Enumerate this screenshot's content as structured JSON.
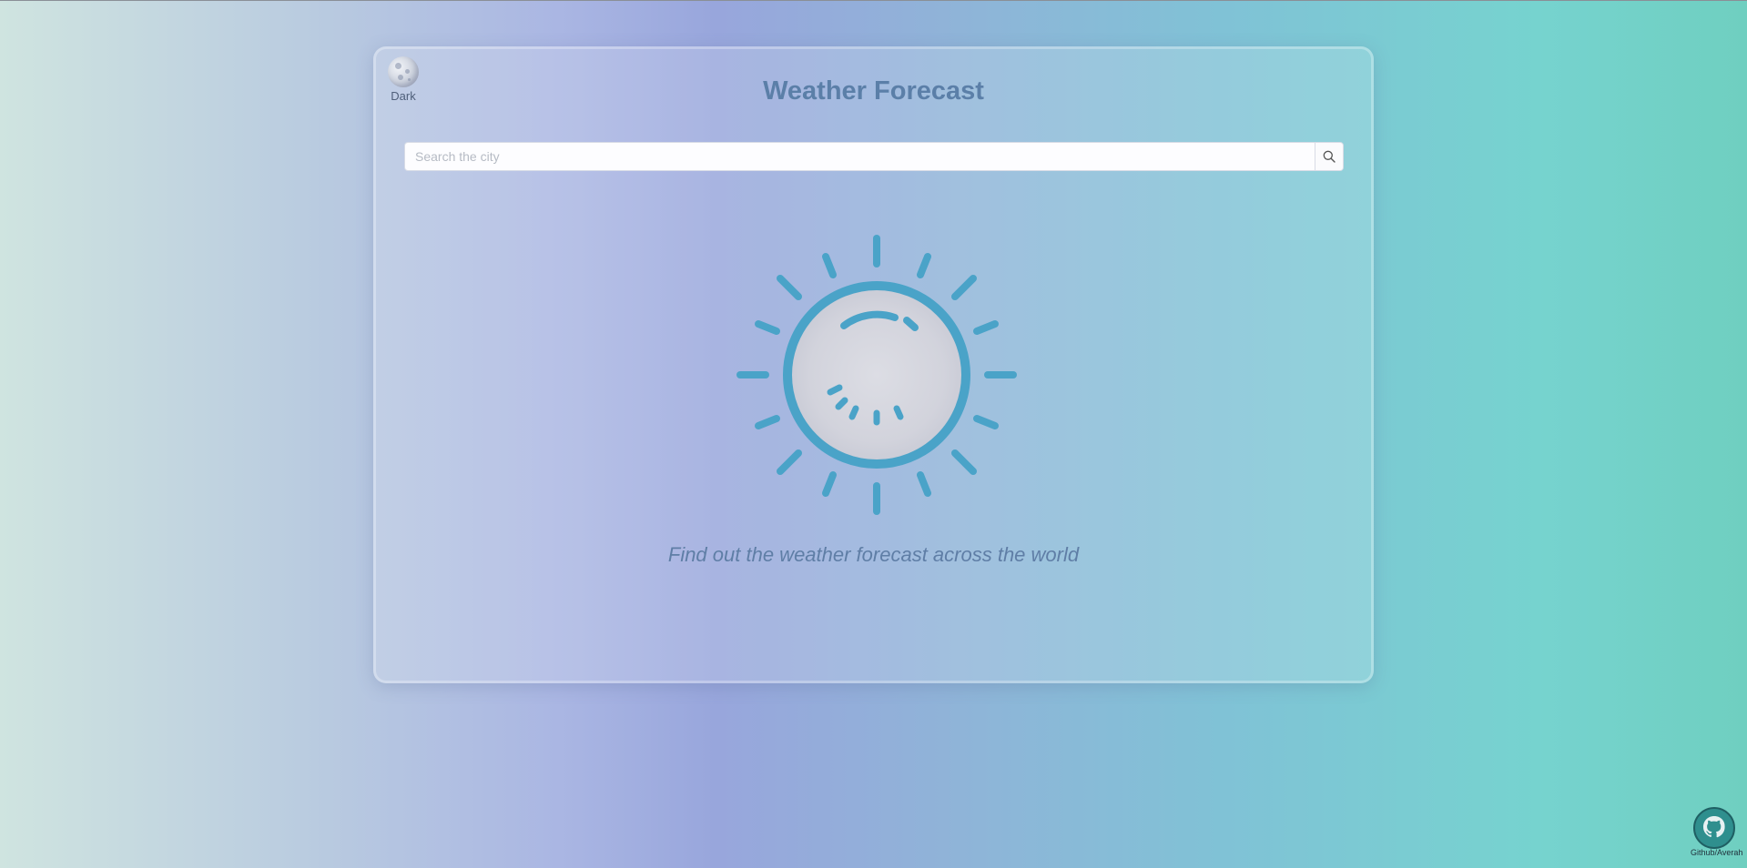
{
  "header": {
    "title": "Weather Forecast",
    "theme_toggle_label": "Dark"
  },
  "search": {
    "placeholder": "Search the city",
    "value": ""
  },
  "main": {
    "illustration_icon": "sun-icon",
    "tagline": "Find out the weather forecast across the world"
  },
  "footer": {
    "github_label": "Github/Averah",
    "github_icon": "github-icon"
  },
  "colors": {
    "accent": "#4aa3c8",
    "title": "#5b7fa8",
    "tagline": "#5f7ea6"
  }
}
